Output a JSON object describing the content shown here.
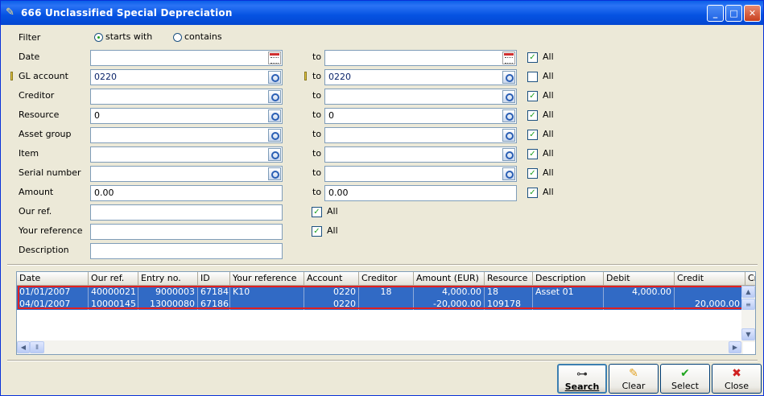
{
  "window": {
    "title": "666 Unclassified Special Depreciation",
    "minimize": "_",
    "maximize": "□",
    "close": "✕"
  },
  "filter": {
    "label": "Filter",
    "opt_starts": "starts with",
    "opt_contains": "contains",
    "selected": "starts with"
  },
  "to_label": "to",
  "all_label": "All",
  "rows": {
    "date": {
      "label": "Date",
      "from": "",
      "to": "",
      "all": true
    },
    "gl": {
      "label": "GL account",
      "from": "0220",
      "to": "0220",
      "all": false
    },
    "creditor": {
      "label": "Creditor",
      "from": "",
      "to": "",
      "all": true
    },
    "resource": {
      "label": "Resource",
      "from": "0",
      "to": "0",
      "all": true
    },
    "assetgroup": {
      "label": "Asset group",
      "from": "",
      "to": "",
      "all": true
    },
    "item": {
      "label": "Item",
      "from": "",
      "to": "",
      "all": true
    },
    "serial": {
      "label": "Serial number",
      "from": "",
      "to": "",
      "all": true
    },
    "amount": {
      "label": "Amount",
      "from": "0.00",
      "to": "0.00",
      "all": true
    },
    "ourref": {
      "label": "Our ref.",
      "value": "",
      "all": true
    },
    "yourref": {
      "label": "Your reference",
      "value": "",
      "all": true
    },
    "description": {
      "label": "Description",
      "value": ""
    }
  },
  "grid": {
    "columns": [
      "Date",
      "Our ref.",
      "Entry no.",
      "ID",
      "Your reference",
      "Account",
      "Creditor",
      "Amount (EUR)",
      "Resource",
      "Description",
      "Debit",
      "Credit",
      "Cr"
    ],
    "rows": [
      [
        "01/01/2007",
        "40000021",
        "9000003",
        "67184",
        "K10",
        "0220",
        "18",
        "4,000.00",
        "18",
        "Asset 01",
        "4,000.00",
        ""
      ],
      [
        "04/01/2007",
        "10000145",
        "13000080",
        "67186",
        "",
        "0220",
        "",
        "-20,000.00",
        "109178",
        "",
        "",
        "20,000.00"
      ]
    ]
  },
  "buttons": {
    "search": "Search",
    "clear": "Clear",
    "select": "Select",
    "close": "Close"
  },
  "colors": {
    "selection": "#316AC5",
    "highlight_box": "#E02020",
    "title_bar": "#0553E2"
  }
}
